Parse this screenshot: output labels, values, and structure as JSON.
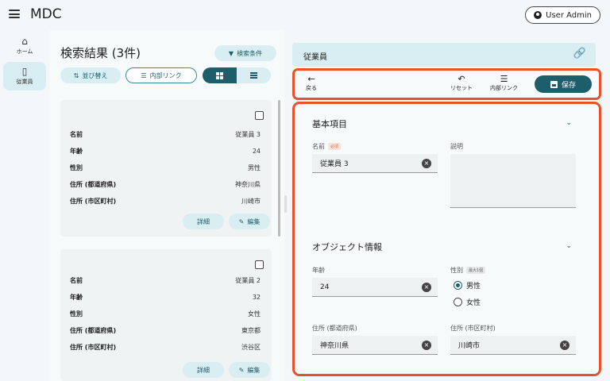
{
  "app": {
    "title": "MDC",
    "user_label": "User Admin"
  },
  "nav": {
    "home_label": "ホーム",
    "employee_label": "従業員"
  },
  "results": {
    "title": "検索結果 (3件)",
    "filter_label": "検索条件",
    "sort_label": "並び替え",
    "link_label": "内部リンク",
    "cards": [
      {
        "rows": [
          {
            "key": "名前",
            "value": "従業員 3"
          },
          {
            "key": "年齢",
            "value": "24"
          },
          {
            "key": "性別",
            "value": "男性"
          },
          {
            "key": "住所 (都道府県)",
            "value": "神奈川県"
          },
          {
            "key": "住所 (市区町村)",
            "value": "川崎市"
          }
        ],
        "detail_label": "詳細",
        "edit_label": "編集"
      },
      {
        "rows": [
          {
            "key": "名前",
            "value": "従業員 2"
          },
          {
            "key": "年齢",
            "value": "32"
          },
          {
            "key": "性別",
            "value": "女性"
          },
          {
            "key": "住所 (都道府県)",
            "value": "東京都"
          },
          {
            "key": "住所 (市区町村)",
            "value": "渋谷区"
          }
        ],
        "detail_label": "詳細",
        "edit_label": "編集"
      }
    ]
  },
  "detail": {
    "header_title": "従業員",
    "toolbar": {
      "back_label": "戻る",
      "reset_label": "リセット",
      "link_label": "内部リンク",
      "save_label": "保存"
    },
    "basic": {
      "title": "基本項目",
      "name_label": "名前",
      "name_required": "必須",
      "name_value": "従業員 3",
      "desc_label": "説明"
    },
    "object": {
      "title": "オブジェクト情報",
      "age_label": "年齢",
      "age_value": "24",
      "gender_label": "性別",
      "gender_badge": "最大1個",
      "gender_options": [
        "男性",
        "女性"
      ],
      "gender_selected": "男性",
      "pref_label": "住所 (都道府県)",
      "pref_value": "神奈川県",
      "city_label": "住所 (市区町村)",
      "city_value": "川崎市"
    }
  },
  "colors": {
    "accent": "#1d5e6a",
    "chip": "#d9eef2",
    "highlight": "#e8512a"
  }
}
